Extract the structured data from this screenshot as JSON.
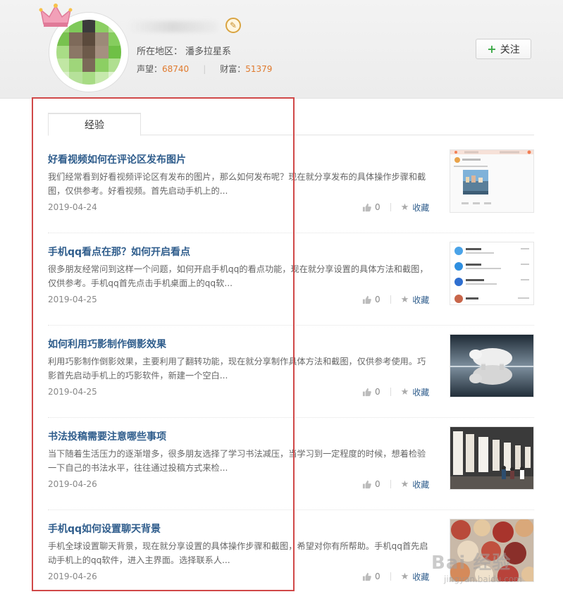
{
  "profile": {
    "region_label": "所在地区：",
    "region_value": "潘多拉星系",
    "reputation_label": "声望：",
    "reputation_value": "68740",
    "wealth_label": "财富：",
    "wealth_value": "51379",
    "follow_label": "关注"
  },
  "tabs": [
    {
      "label": "经验",
      "active": true
    }
  ],
  "articles": [
    {
      "title": "好看视频如何在评论区发布图片",
      "desc": "我们经常看到好看视频评论区有发布的图片，那么如何发布呢？现在就分享发布的具体操作步骤和截图，仅供参考。好看视频。首先启动手机上的...",
      "date": "2019-04-24",
      "likes": "0",
      "fav_label": "收藏"
    },
    {
      "title": "手机qq看点在那？如何开启看点",
      "desc": "很多朋友经常问到这样一个问题，如何开启手机qq的看点功能，现在就分享设置的具体方法和截图，仅供参考。手机qq首先点击手机桌面上的qq软...",
      "date": "2019-04-25",
      "likes": "0",
      "fav_label": "收藏"
    },
    {
      "title": "如何利用巧影制作倒影效果",
      "desc": "利用巧影制作倒影效果，主要利用了翻转功能，现在就分享制作具体方法和截图，仅供参考使用。巧影首先启动手机上的巧影软件，新建一个空白...",
      "date": "2019-04-25",
      "likes": "0",
      "fav_label": "收藏"
    },
    {
      "title": "书法投稿需要注意哪些事项",
      "desc": "当下随着生活压力的逐渐增多，很多朋友选择了学习书法减压，当学习到一定程度的时候，想着检验一下自己的书法水平，往往通过投稿方式来检...",
      "date": "2019-04-26",
      "likes": "0",
      "fav_label": "收藏"
    },
    {
      "title": "手机qq如何设置聊天背景",
      "desc": "手机全球设置聊天背景，现在就分享设置的具体操作步骤和截图，希望对你有所帮助。手机qq首先启动手机上的qq软件，进入主界面。选择联系人...",
      "date": "2019-04-26",
      "likes": "0",
      "fav_label": "收藏"
    }
  ],
  "watermark": {
    "brand": "Bai 经验",
    "url": "jingyan.baidu.com"
  },
  "colors": {
    "title_link": "#2f5d8c",
    "stat_number": "#e07a2e",
    "highlight_border": "#d04848",
    "follow_plus": "#3aa845"
  }
}
